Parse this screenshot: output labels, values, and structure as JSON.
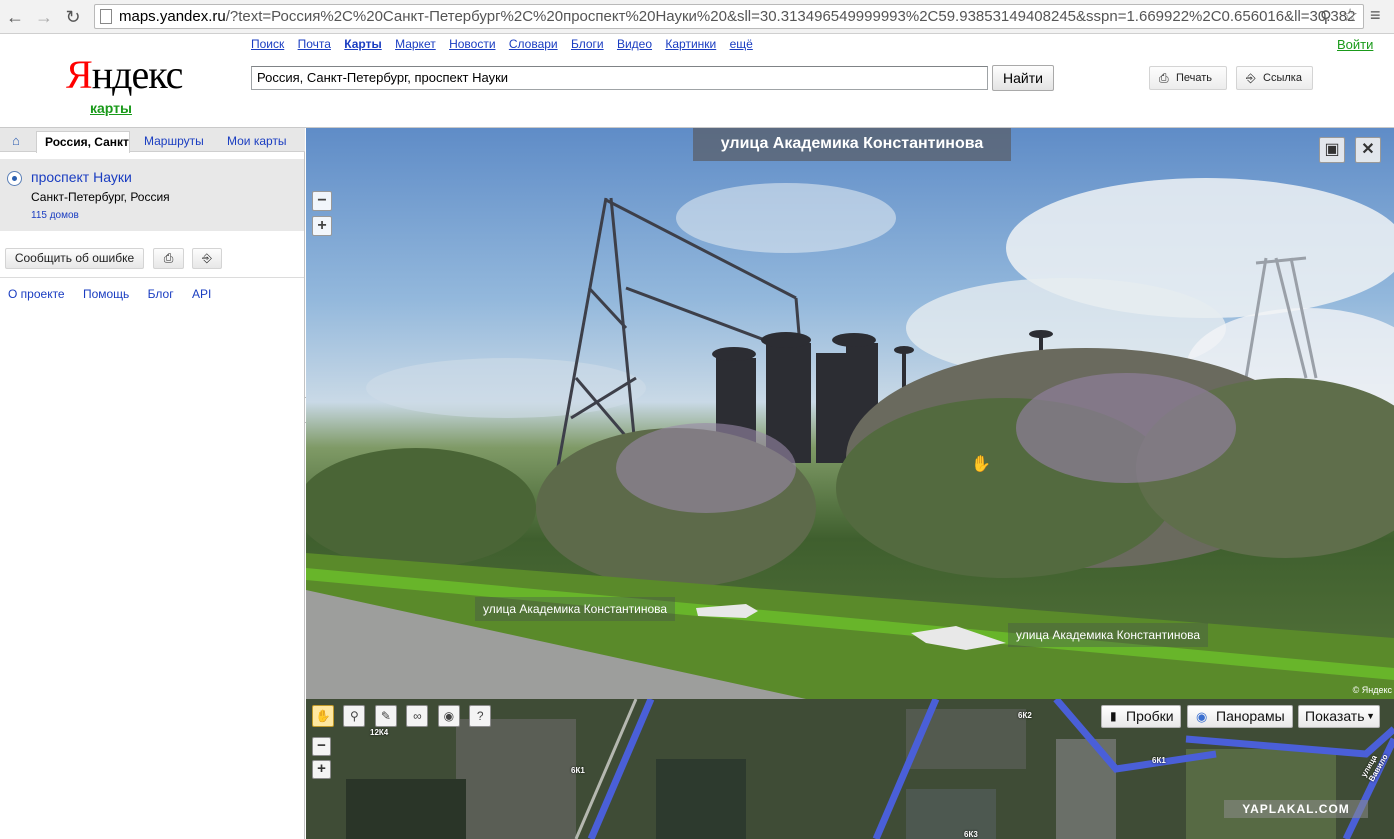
{
  "browser": {
    "url_host": "maps.yandex.ru",
    "url_path": "/?text=Россия%2C%20Санкт-Петербург%2C%20проспект%20Науки%20&sll=30.313496549999993%2C59.93853149408245&sspn=1.669922%2C0.656016&ll=30.382"
  },
  "header": {
    "logo_first": "Я",
    "logo_rest": "ндекс",
    "logo_sub": "карты",
    "services": [
      "Поиск",
      "Почта",
      "Карты",
      "Маркет",
      "Новости",
      "Словари",
      "Блоги",
      "Видео",
      "Картинки",
      "ещё"
    ],
    "login": "Войти",
    "search_value": "Россия, Санкт-Петербург, проспект Науки",
    "search_button": "Найти",
    "print_label": "Печать",
    "link_label": "Ссылка"
  },
  "sidebar": {
    "tab_active": "Россия, Санкт-",
    "tab_routes": "Маршруты",
    "tab_mymaps": "Мои карты",
    "result_title": "проспект Науки",
    "result_address": "Санкт-Петербург, Россия",
    "result_count": "115 домов",
    "report_error": "Сообщить об ошибке",
    "links": [
      "О проекте",
      "Помощь",
      "Блог",
      "API"
    ]
  },
  "panorama": {
    "title": "улица Академика Константинова",
    "street_label_1": "улица Академика Константинова",
    "street_label_2": "улица Академика Константинова",
    "copyright": "© Яндекс"
  },
  "map": {
    "traffic": "Пробки",
    "panoramas": "Панорамы",
    "show": "Показать",
    "building_labels": [
      "12К4",
      "6К1",
      "6К2",
      "6К1",
      "6К3"
    ],
    "street_name": "улица Вавило",
    "watermark": "YAPLAKAL.COM"
  },
  "colors": {
    "link": "#1a3dc1",
    "brand_red": "#ff0000",
    "brand_green": "#1a9a1a",
    "route_blue": "#4a5fd8"
  }
}
